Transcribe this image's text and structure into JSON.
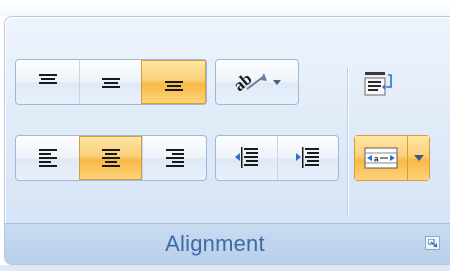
{
  "group": {
    "title": "Alignment"
  },
  "buttons": [
    {
      "name": "top-align-button",
      "icon": "align-top-icon",
      "state": "normal"
    },
    {
      "name": "middle-align-button",
      "icon": "align-middle-icon",
      "state": "normal"
    },
    {
      "name": "bottom-align-button",
      "icon": "align-bottom-icon",
      "state": "selected"
    },
    {
      "name": "orientation-button",
      "icon": "text-orientation-icon",
      "state": "normal"
    },
    {
      "name": "align-left-button",
      "icon": "align-left-icon",
      "state": "normal"
    },
    {
      "name": "center-button",
      "icon": "align-center-icon",
      "state": "selected"
    },
    {
      "name": "align-right-button",
      "icon": "align-right-icon",
      "state": "normal"
    },
    {
      "name": "decrease-indent-button",
      "icon": "decrease-indent-icon",
      "state": "normal"
    },
    {
      "name": "increase-indent-button",
      "icon": "increase-indent-icon",
      "state": "normal"
    },
    {
      "name": "wrap-text-button",
      "icon": "wrap-text-icon",
      "state": "normal"
    },
    {
      "name": "merge-center-button",
      "icon": "merge-center-icon",
      "state": "selected"
    }
  ],
  "colors": {
    "accent_selected": "#f8b948",
    "group_border": "#9fb8d8",
    "label_text": "#3e6aa6"
  }
}
